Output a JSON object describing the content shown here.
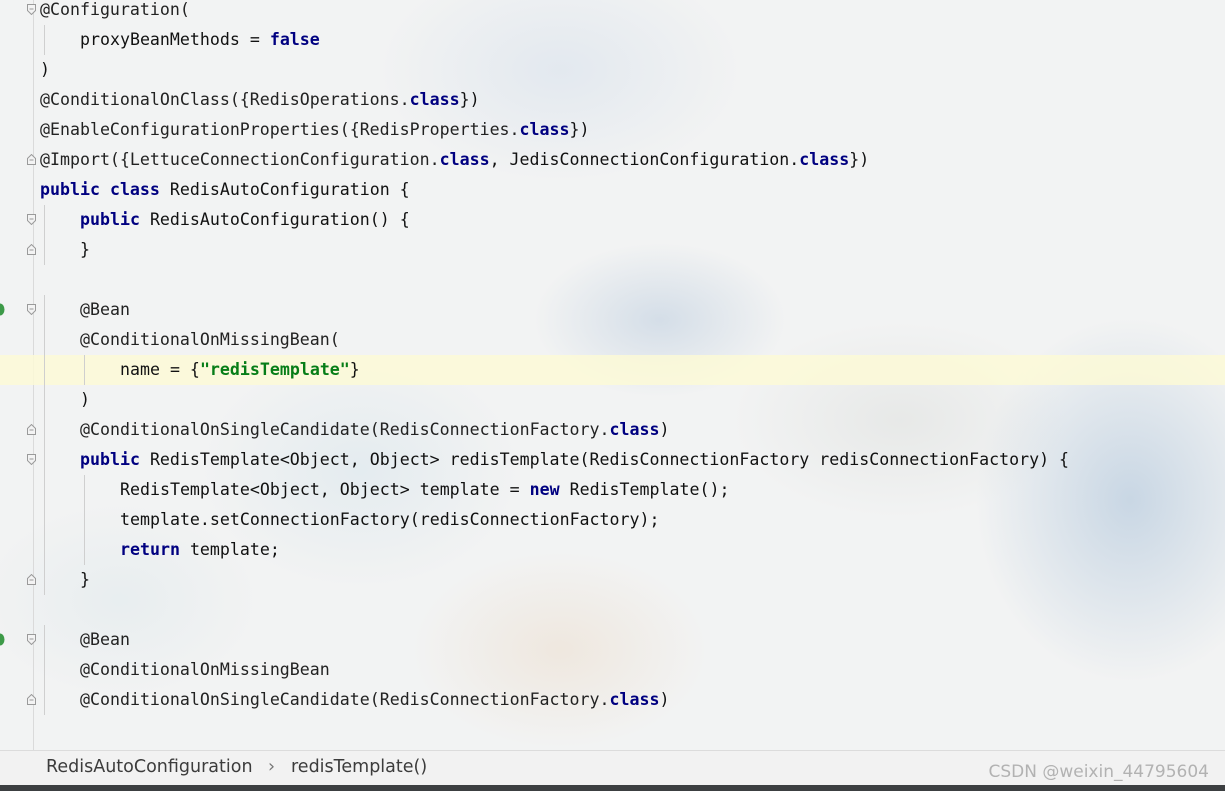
{
  "editor": {
    "lines": [
      {
        "tokens": [
          {
            "t": "@Configuration(",
            "c": "ann"
          }
        ],
        "indent": 0,
        "fold": "open"
      },
      {
        "tokens": [
          {
            "t": "proxyBeanMethods = ",
            "c": "txt"
          },
          {
            "t": "false",
            "c": "kw"
          }
        ],
        "indent": 1
      },
      {
        "tokens": [
          {
            "t": ")",
            "c": "txt"
          }
        ],
        "indent": 0
      },
      {
        "tokens": [
          {
            "t": "@ConditionalOnClass({RedisOperations.",
            "c": "ann"
          },
          {
            "t": "class",
            "c": "kw"
          },
          {
            "t": "})",
            "c": "txt"
          }
        ],
        "indent": 0
      },
      {
        "tokens": [
          {
            "t": "@EnableConfigurationProperties({RedisProperties.",
            "c": "ann"
          },
          {
            "t": "class",
            "c": "kw"
          },
          {
            "t": "})",
            "c": "txt"
          }
        ],
        "indent": 0
      },
      {
        "tokens": [
          {
            "t": "@Import({LettuceConnectionConfiguration.",
            "c": "ann"
          },
          {
            "t": "class",
            "c": "kw"
          },
          {
            "t": ", JedisConnectionConfiguration.",
            "c": "txt"
          },
          {
            "t": "class",
            "c": "kw"
          },
          {
            "t": "})",
            "c": "txt"
          }
        ],
        "indent": 0,
        "fold": "end"
      },
      {
        "tokens": [
          {
            "t": "public",
            "c": "kw"
          },
          {
            "t": " ",
            "c": "txt"
          },
          {
            "t": "class",
            "c": "kw"
          },
          {
            "t": " RedisAutoConfiguration {",
            "c": "txt"
          }
        ],
        "indent": 0
      },
      {
        "tokens": [
          {
            "t": "public",
            "c": "kw"
          },
          {
            "t": " RedisAutoConfiguration() {",
            "c": "txt"
          }
        ],
        "indent": 1,
        "fold": "open"
      },
      {
        "tokens": [
          {
            "t": "}",
            "c": "txt"
          }
        ],
        "indent": 1,
        "fold": "end"
      },
      {
        "tokens": [],
        "indent": 0
      },
      {
        "tokens": [
          {
            "t": "@Bean",
            "c": "ann"
          }
        ],
        "indent": 1,
        "fold": "open",
        "bean": true
      },
      {
        "tokens": [
          {
            "t": "@ConditionalOnMissingBean(",
            "c": "ann"
          }
        ],
        "indent": 1
      },
      {
        "tokens": [
          {
            "t": "name = {",
            "c": "txt"
          },
          {
            "t": "\"redisTemplate\"",
            "c": "str"
          },
          {
            "t": "}",
            "c": "txt"
          }
        ],
        "indent": 2,
        "highlight": true
      },
      {
        "tokens": [
          {
            "t": ")",
            "c": "txt"
          }
        ],
        "indent": 1
      },
      {
        "tokens": [
          {
            "t": "@ConditionalOnSingleCandidate(RedisConnectionFactory.",
            "c": "ann"
          },
          {
            "t": "class",
            "c": "kw"
          },
          {
            "t": ")",
            "c": "txt"
          }
        ],
        "indent": 1,
        "fold": "end"
      },
      {
        "tokens": [
          {
            "t": "public",
            "c": "kw"
          },
          {
            "t": " RedisTemplate<Object, Object> redisTemplate(RedisConnectionFactory redisConnectionFactory) {",
            "c": "txt"
          }
        ],
        "indent": 1,
        "fold": "open"
      },
      {
        "tokens": [
          {
            "t": "RedisTemplate<Object, Object> template = ",
            "c": "txt"
          },
          {
            "t": "new",
            "c": "kw"
          },
          {
            "t": " RedisTemplate();",
            "c": "txt"
          }
        ],
        "indent": 2
      },
      {
        "tokens": [
          {
            "t": "template.setConnectionFactory(redisConnectionFactory);",
            "c": "txt"
          }
        ],
        "indent": 2
      },
      {
        "tokens": [
          {
            "t": "return",
            "c": "kw"
          },
          {
            "t": " template;",
            "c": "txt"
          }
        ],
        "indent": 2
      },
      {
        "tokens": [
          {
            "t": "}",
            "c": "txt"
          }
        ],
        "indent": 1,
        "fold": "end"
      },
      {
        "tokens": [],
        "indent": 0
      },
      {
        "tokens": [
          {
            "t": "@Bean",
            "c": "ann"
          }
        ],
        "indent": 1,
        "fold": "open",
        "bean": true
      },
      {
        "tokens": [
          {
            "t": "@ConditionalOnMissingBean",
            "c": "ann"
          }
        ],
        "indent": 1
      },
      {
        "tokens": [
          {
            "t": "@ConditionalOnSingleCandidate(RedisConnectionFactory.",
            "c": "ann"
          },
          {
            "t": "class",
            "c": "kw"
          },
          {
            "t": ")",
            "c": "txt"
          }
        ],
        "indent": 1,
        "fold": "end"
      }
    ]
  },
  "breadcrumb": {
    "items": [
      "RedisAutoConfiguration",
      "redisTemplate()"
    ],
    "separator": "›"
  },
  "watermark": "CSDN @weixin_44795604",
  "colors": {
    "keyword": "#000080",
    "string": "#067d17",
    "line_highlight": "#fcfad6",
    "bean_gutter_icon": "#3d9a48",
    "status_bar": "#3c3f41"
  }
}
